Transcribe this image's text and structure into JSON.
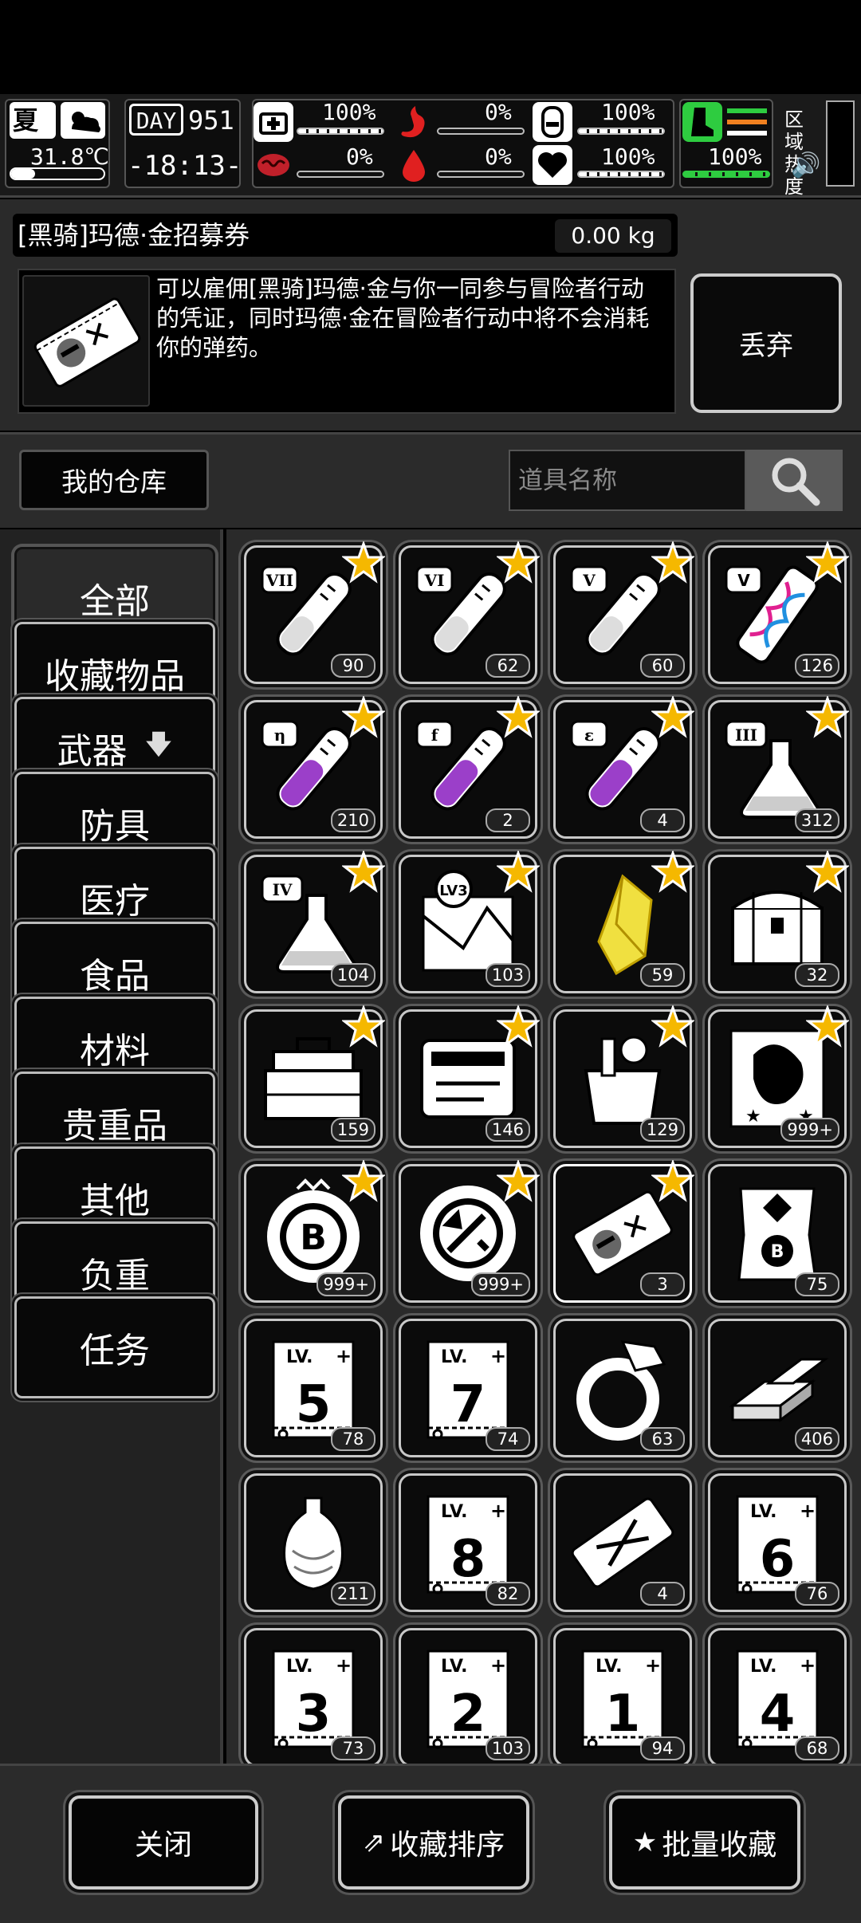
{
  "status": {
    "season": "夏",
    "temperature": "31.8℃",
    "day_label": "DAY",
    "day": "951",
    "time": "-18:13-",
    "region_label": "区域热度",
    "stats": {
      "health": "100%",
      "stomach": "0%",
      "bladder": "100%",
      "brain": "0%",
      "blood": "0%",
      "heart": "100%",
      "stamina": "100%"
    }
  },
  "item": {
    "name": "[黑骑]玛德·金招募券",
    "weight": "0.00 kg",
    "description": "可以雇佣[黑骑]玛德·金与你一同参与冒险者行动的凭证，同时玛德·金在冒险者行动中将不会消耗你的弹药。",
    "discard_label": "丢弃"
  },
  "warehouse": {
    "label": "我的仓库",
    "search_placeholder": "道具名称"
  },
  "categories": [
    "全部",
    "收藏物品",
    "武器",
    "防具",
    "医疗",
    "食品",
    "材料",
    "贵重品",
    "其他",
    "负重",
    "任务"
  ],
  "items": [
    {
      "icon": "tube-VII",
      "roman": "VII",
      "count": "90",
      "fav": true
    },
    {
      "icon": "tube-VI",
      "roman": "VI",
      "count": "62",
      "fav": true
    },
    {
      "icon": "tube-V",
      "roman": "V",
      "count": "60",
      "fav": true
    },
    {
      "icon": "dna-syringe-V",
      "roman": "V",
      "count": "126",
      "fav": true
    },
    {
      "icon": "purple-tube-eta",
      "roman": "η",
      "count": "210",
      "fav": true
    },
    {
      "icon": "purple-tube-f",
      "roman": "f",
      "count": "2",
      "fav": true
    },
    {
      "icon": "purple-tube-epsilon",
      "roman": "ε",
      "count": "4",
      "fav": true
    },
    {
      "icon": "flask-III",
      "roman": "III",
      "count": "312",
      "fav": true
    },
    {
      "icon": "flask-IV",
      "roman": "IV",
      "count": "104",
      "fav": true
    },
    {
      "icon": "map-lv3",
      "roman": "LV3",
      "count": "103",
      "fav": true
    },
    {
      "icon": "yellow-crystal",
      "roman": "",
      "count": "59",
      "fav": true
    },
    {
      "icon": "treasure-chest",
      "roman": "",
      "count": "32",
      "fav": true
    },
    {
      "icon": "toolbox",
      "roman": "",
      "count": "159",
      "fav": true
    },
    {
      "icon": "tool-case",
      "roman": "",
      "count": "146",
      "fav": true
    },
    {
      "icon": "supply-bag",
      "roman": "",
      "count": "129",
      "fav": true
    },
    {
      "icon": "monster-card",
      "roman": "",
      "count": "999+",
      "fav": true
    },
    {
      "icon": "b-coin",
      "roman": "B",
      "count": "999+",
      "fav": true
    },
    {
      "icon": "repair-coin",
      "roman": "",
      "count": "999+",
      "fav": true
    },
    {
      "icon": "recruit-ticket",
      "roman": "",
      "count": "3",
      "fav": true,
      "selected": true
    },
    {
      "icon": "b-scroll",
      "roman": "B",
      "count": "75",
      "fav": false
    },
    {
      "icon": "lv-ticket-5",
      "roman": "5",
      "count": "78",
      "fav": false
    },
    {
      "icon": "lv-ticket-7",
      "roman": "7",
      "count": "74",
      "fav": false
    },
    {
      "icon": "diamond-ring",
      "roman": "",
      "count": "63",
      "fav": false
    },
    {
      "icon": "gold-bars",
      "roman": "",
      "count": "406",
      "fav": false
    },
    {
      "icon": "vase",
      "roman": "",
      "count": "211",
      "fav": false
    },
    {
      "icon": "lv-ticket-8",
      "roman": "8",
      "count": "82",
      "fav": false
    },
    {
      "icon": "crossed-ticket",
      "roman": "",
      "count": "4",
      "fav": false
    },
    {
      "icon": "lv-ticket-6",
      "roman": "6",
      "count": "76",
      "fav": false
    },
    {
      "icon": "lv-ticket-3",
      "roman": "3",
      "count": "73",
      "fav": false
    },
    {
      "icon": "lv-ticket-2",
      "roman": "2",
      "count": "103",
      "fav": false
    },
    {
      "icon": "lv-ticket-1",
      "roman": "1",
      "count": "94",
      "fav": false
    },
    {
      "icon": "lv-ticket-4",
      "roman": "4",
      "count": "68",
      "fav": false
    }
  ],
  "bottom": {
    "close_label": "关闭",
    "sort_label": "收藏排序",
    "batch_label": "批量收藏"
  },
  "colors": {
    "star": "#f5b800",
    "stomach": "#e02020",
    "stamina_green": "#2ecc40",
    "potion_purple": "#9b3fc9",
    "crystal_yellow": "#f0e040"
  }
}
